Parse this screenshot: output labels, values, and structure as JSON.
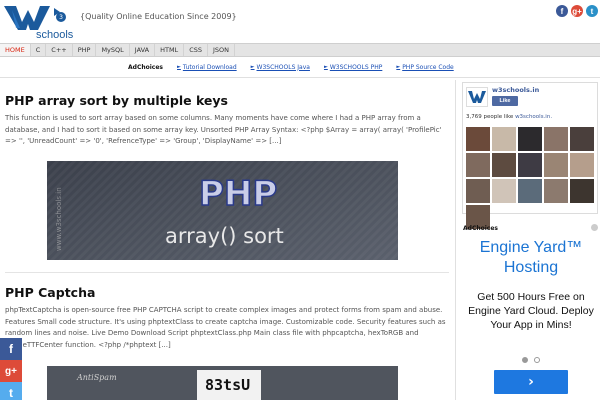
{
  "header": {
    "logo_text": "schools",
    "logo_badge": "3",
    "tagline": "{Quality Online Education Since 2009}",
    "social": [
      {
        "icon": "facebook-icon",
        "glyph": "f"
      },
      {
        "icon": "googleplus-icon",
        "glyph": "g+"
      },
      {
        "icon": "twitter-icon",
        "glyph": "t"
      }
    ]
  },
  "nav": {
    "items": [
      "HOME",
      "C",
      "C++",
      "PHP",
      "MySQL",
      "JAVA",
      "HTML",
      "CSS",
      "JSON"
    ],
    "active": "HOME"
  },
  "adbar": {
    "adchoices": "AdChoices",
    "links": [
      "Tutorial Download",
      "W3SCHOOLS Java",
      "W3SCHOOLS PHP",
      "PHP Source Code"
    ]
  },
  "posts": [
    {
      "title": "PHP array sort by multiple keys",
      "body": "This function is used to sort array based on some columns. Many moments have come where I had a PHP array from a database, and I had to sort it based on some array key. Unsorted PHP Array Syntax: <?php $Array = array( array( 'ProfilePic' => '', 'UnreadCount' => '0', 'RefrenceType' => 'Group', 'DisplayName' => [...]",
      "image": {
        "watermark": "www.w3schools.in",
        "logo": "PHP",
        "caption": "array() sort"
      }
    },
    {
      "title": "PHP Captcha",
      "body": "phpTextCaptcha is open-source free PHP CAPTCHA script to create complex images and protect forms from spam and abuse. Features Small code structure. It's using phptextClass to create captcha image. Customizable code. Security features such as random lines and noise. Live Demo Download Script phptextClass.php Main class file with phpcaptcha, hexToRGB and ImageTTFCenter function. <?php /*phptext [...]",
      "image": {
        "label": "AntiSpam",
        "code": "83tsU"
      }
    }
  ],
  "sidebar": {
    "fb": {
      "page_name": "w3schools.in",
      "like_label": "Like",
      "count_text": "3,769 people like ",
      "count_link": "w3schools.in."
    },
    "ad": {
      "adchoices": "AdChoices",
      "headline": "Engine Yard™ Hosting",
      "body": "Get 500 Hours Free on Engine Yard Cloud. Deploy Your App in Mins!",
      "button": "›"
    }
  },
  "float_share": [
    {
      "icon": "facebook-icon",
      "glyph": "f"
    },
    {
      "icon": "googleplus-icon",
      "glyph": "g+"
    },
    {
      "icon": "twitter-icon",
      "glyph": "t"
    }
  ],
  "colors": {
    "brand_blue": "#1b5a9c",
    "nav_active": "#d9230f",
    "link_blue": "#1a4fb5",
    "ad_blue": "#1b74d3",
    "facebook": "#3b5998",
    "googleplus": "#dd4b39",
    "twitter": "#55acee"
  }
}
